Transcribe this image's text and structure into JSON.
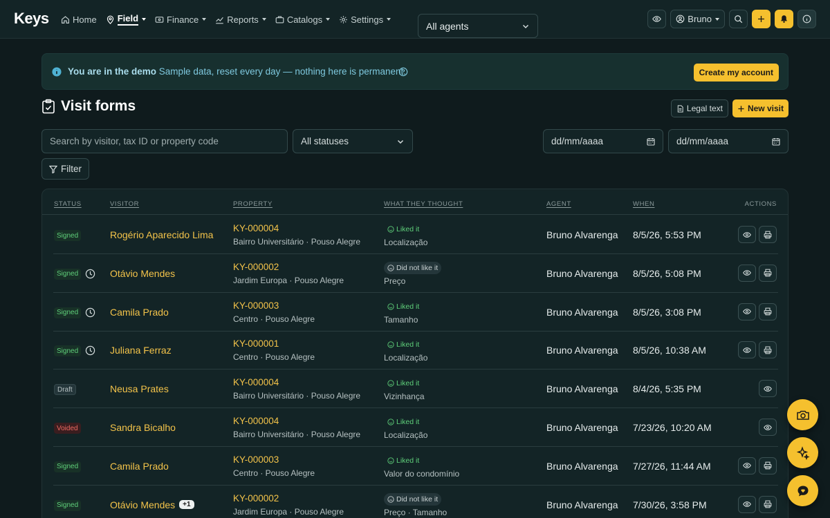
{
  "app": {
    "logo": "Keys"
  },
  "nav": {
    "home": "Home",
    "field": "Field",
    "finance": "Finance",
    "reports": "Reports",
    "catalogs": "Catalogs",
    "settings": "Settings"
  },
  "user": {
    "name": "Bruno"
  },
  "banner": {
    "bold": "You are in the demo",
    "text": "Sample data, reset every day — nothing here is permanent.",
    "cta": "Create my account"
  },
  "page": {
    "title": "Visit forms",
    "legal_button": "Legal text",
    "new_button": "New visit"
  },
  "filters": {
    "search_placeholder": "Search by visitor, tax ID or property code",
    "status_value": "All statuses",
    "agent_value": "All agents",
    "date_from": "dd/mm/aaaa",
    "date_to": "dd/mm/aaaa",
    "filter_button": "Filter"
  },
  "table": {
    "headers": {
      "status": "STATUS",
      "visitor": "VISITOR",
      "property": "PROPERTY",
      "thought": "WHAT THEY THOUGHT",
      "agent": "AGENT",
      "when": "WHEN",
      "actions": "ACTIONS"
    },
    "rows": [
      {
        "status": "Signed",
        "clock": false,
        "visitor": "Rogério Aparecido Lima",
        "extra": "",
        "code": "KY-000004",
        "location": "Bairro Universitário · Pouso Alegre",
        "opinion": "Liked it",
        "reason": "Localização",
        "agent": "Bruno Alvarenga",
        "when": "8/5/26, 5:53 PM",
        "print": true
      },
      {
        "status": "Signed",
        "clock": true,
        "visitor": "Otávio Mendes",
        "extra": "",
        "code": "KY-000002",
        "location": "Jardim Europa · Pouso Alegre",
        "opinion": "Did not like it",
        "reason": "Preço",
        "agent": "Bruno Alvarenga",
        "when": "8/5/26, 5:08 PM",
        "print": true
      },
      {
        "status": "Signed",
        "clock": true,
        "visitor": "Camila Prado",
        "extra": "",
        "code": "KY-000003",
        "location": "Centro · Pouso Alegre",
        "opinion": "Liked it",
        "reason": "Tamanho",
        "agent": "Bruno Alvarenga",
        "when": "8/5/26, 3:08 PM",
        "print": true
      },
      {
        "status": "Signed",
        "clock": true,
        "visitor": "Juliana Ferraz",
        "extra": "",
        "code": "KY-000001",
        "location": "Centro · Pouso Alegre",
        "opinion": "Liked it",
        "reason": "Localização",
        "agent": "Bruno Alvarenga",
        "when": "8/5/26, 10:38 AM",
        "print": true
      },
      {
        "status": "Draft",
        "clock": false,
        "visitor": "Neusa Prates",
        "extra": "",
        "code": "KY-000004",
        "location": "Bairro Universitário · Pouso Alegre",
        "opinion": "Liked it",
        "reason": "Vizinhança",
        "agent": "Bruno Alvarenga",
        "when": "8/4/26, 5:35 PM",
        "print": false
      },
      {
        "status": "Voided",
        "clock": false,
        "visitor": "Sandra Bicalho",
        "extra": "",
        "code": "KY-000004",
        "location": "Bairro Universitário · Pouso Alegre",
        "opinion": "Liked it",
        "reason": "Localização",
        "agent": "Bruno Alvarenga",
        "when": "7/23/26, 10:20 AM",
        "print": false
      },
      {
        "status": "Signed",
        "clock": false,
        "visitor": "Camila Prado",
        "extra": "",
        "code": "KY-000003",
        "location": "Centro · Pouso Alegre",
        "opinion": "Liked it",
        "reason": "Valor do condomínio",
        "agent": "Bruno Alvarenga",
        "when": "7/27/26, 11:44 AM",
        "print": true
      },
      {
        "status": "Signed",
        "clock": false,
        "visitor": "Otávio Mendes",
        "extra": "+1",
        "code": "KY-000002",
        "location": "Jardim Europa · Pouso Alegre",
        "opinion": "Did not like it",
        "reason": "Preço · Tamanho",
        "agent": "Bruno Alvarenga",
        "when": "7/30/26, 3:58 PM",
        "print": true
      }
    ]
  },
  "colors": {
    "background": "#0f1b1d",
    "accent": "#f5c02e",
    "link": "#f3c34a",
    "signed": "#5fd07a",
    "voided": "#ef6a62",
    "info": "#7fc9df"
  },
  "icons": {
    "nav": [
      "home-icon",
      "map-pin-icon",
      "wallet-icon",
      "chart-line-icon",
      "briefcase-icon",
      "gear-icon"
    ],
    "top": [
      "eye-icon",
      "user-circle-icon",
      "search-icon",
      "plus-icon",
      "bell-icon",
      "info-icon"
    ],
    "fabs": [
      "camera-icon",
      "sparkle-icon",
      "chat-heart-icon"
    ]
  }
}
